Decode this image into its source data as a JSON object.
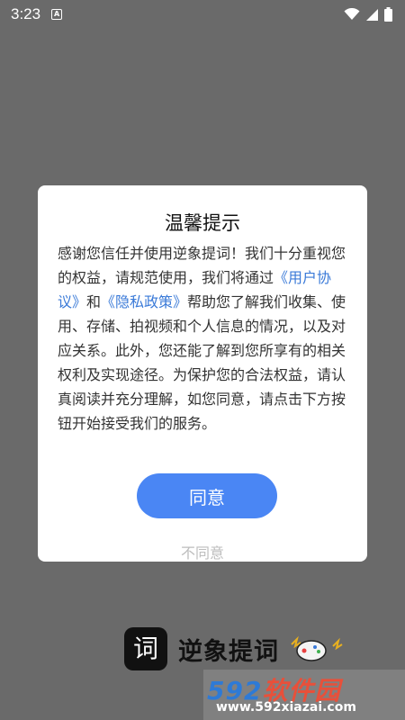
{
  "status_bar": {
    "time": "3:23",
    "notification_glyph": "A",
    "icons": [
      "wifi-icon",
      "signal-icon",
      "battery-icon"
    ]
  },
  "dialog": {
    "title": "温馨提示",
    "body": {
      "text_1": "感谢您信任并使用逆象提词！我们十分重视您的权益，请规范使用，我们将通过",
      "user_agreement_link": "《用户协议》",
      "text_2": "和",
      "privacy_policy_link": "《隐私政策》",
      "text_3": "帮助您了解我们收集、使用、存储、拍视频和个人信息的情况，以及对应关系。此外，您还能了解到您所享有的相关权利及实现途径。为保护您的合法权益，请认真阅读并充分理解，如您同意，请点击下方按钮开始接受我们的服务。"
    },
    "agree_label": "同意",
    "disagree_label": "不同意"
  },
  "brand": {
    "logo_glyph": "词",
    "name": "逆象提词"
  },
  "watermark": {
    "number": "592",
    "label": "软件园",
    "url": "www.592xiazai.com"
  },
  "colors": {
    "overlay": "#6a6a6a",
    "accent": "#4a86f4",
    "link": "#3a7ad8",
    "disagree_text": "#bdbdbd"
  }
}
